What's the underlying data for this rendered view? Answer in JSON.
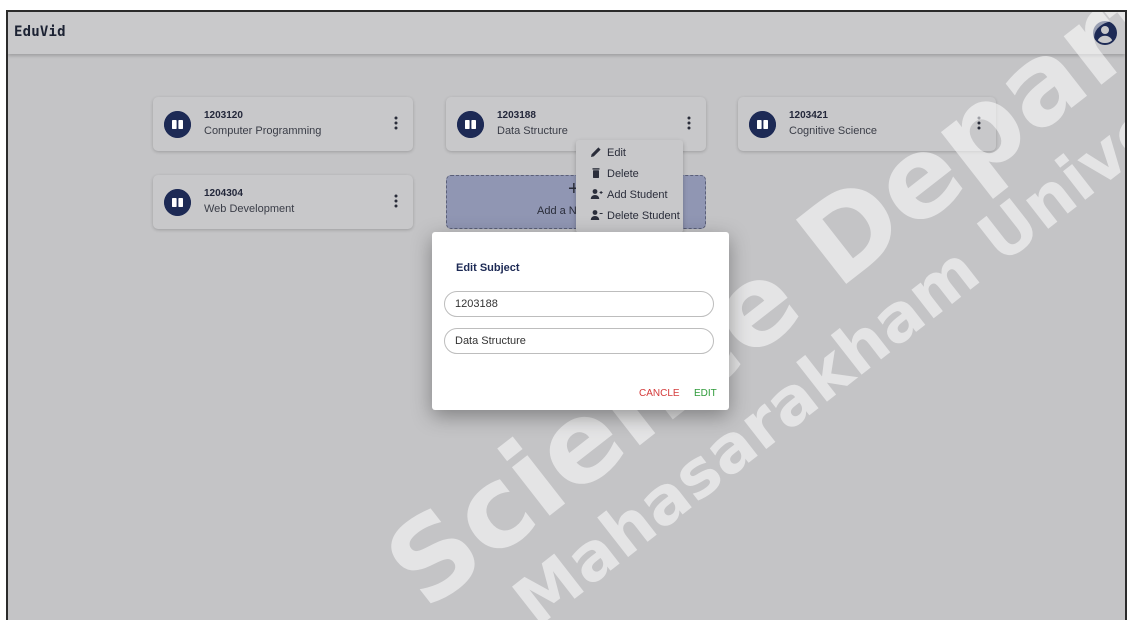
{
  "app": {
    "brand": "EduVid"
  },
  "subjects": [
    {
      "code": "1203120",
      "name": "Computer Programming"
    },
    {
      "code": "1203188",
      "name": "Data Structure"
    },
    {
      "code": "1203421",
      "name": "Cognitive Science"
    },
    {
      "code": "1204304",
      "name": "Web Development"
    }
  ],
  "add_card": {
    "plus": "+",
    "label": "Add a Ne"
  },
  "context_menu": {
    "edit": "Edit",
    "delete": "Delete",
    "add_student": "Add Student",
    "delete_student": "Delete Student"
  },
  "dialog": {
    "title": "Edit Subject",
    "code_value": "1203188",
    "name_value": "Data Structure",
    "cancel_label": "CANCLE",
    "edit_label": "EDIT"
  },
  "watermark": {
    "line1": "Science Department",
    "line2": "Mahasarakham University"
  },
  "colors": {
    "brand_navy": "#1d2a55",
    "cancel_red": "#d43a3a",
    "edit_green": "#2d9a38"
  },
  "icons": {
    "subject": "book-icon",
    "more": "kebab-menu-icon",
    "account": "account-circle-icon"
  }
}
